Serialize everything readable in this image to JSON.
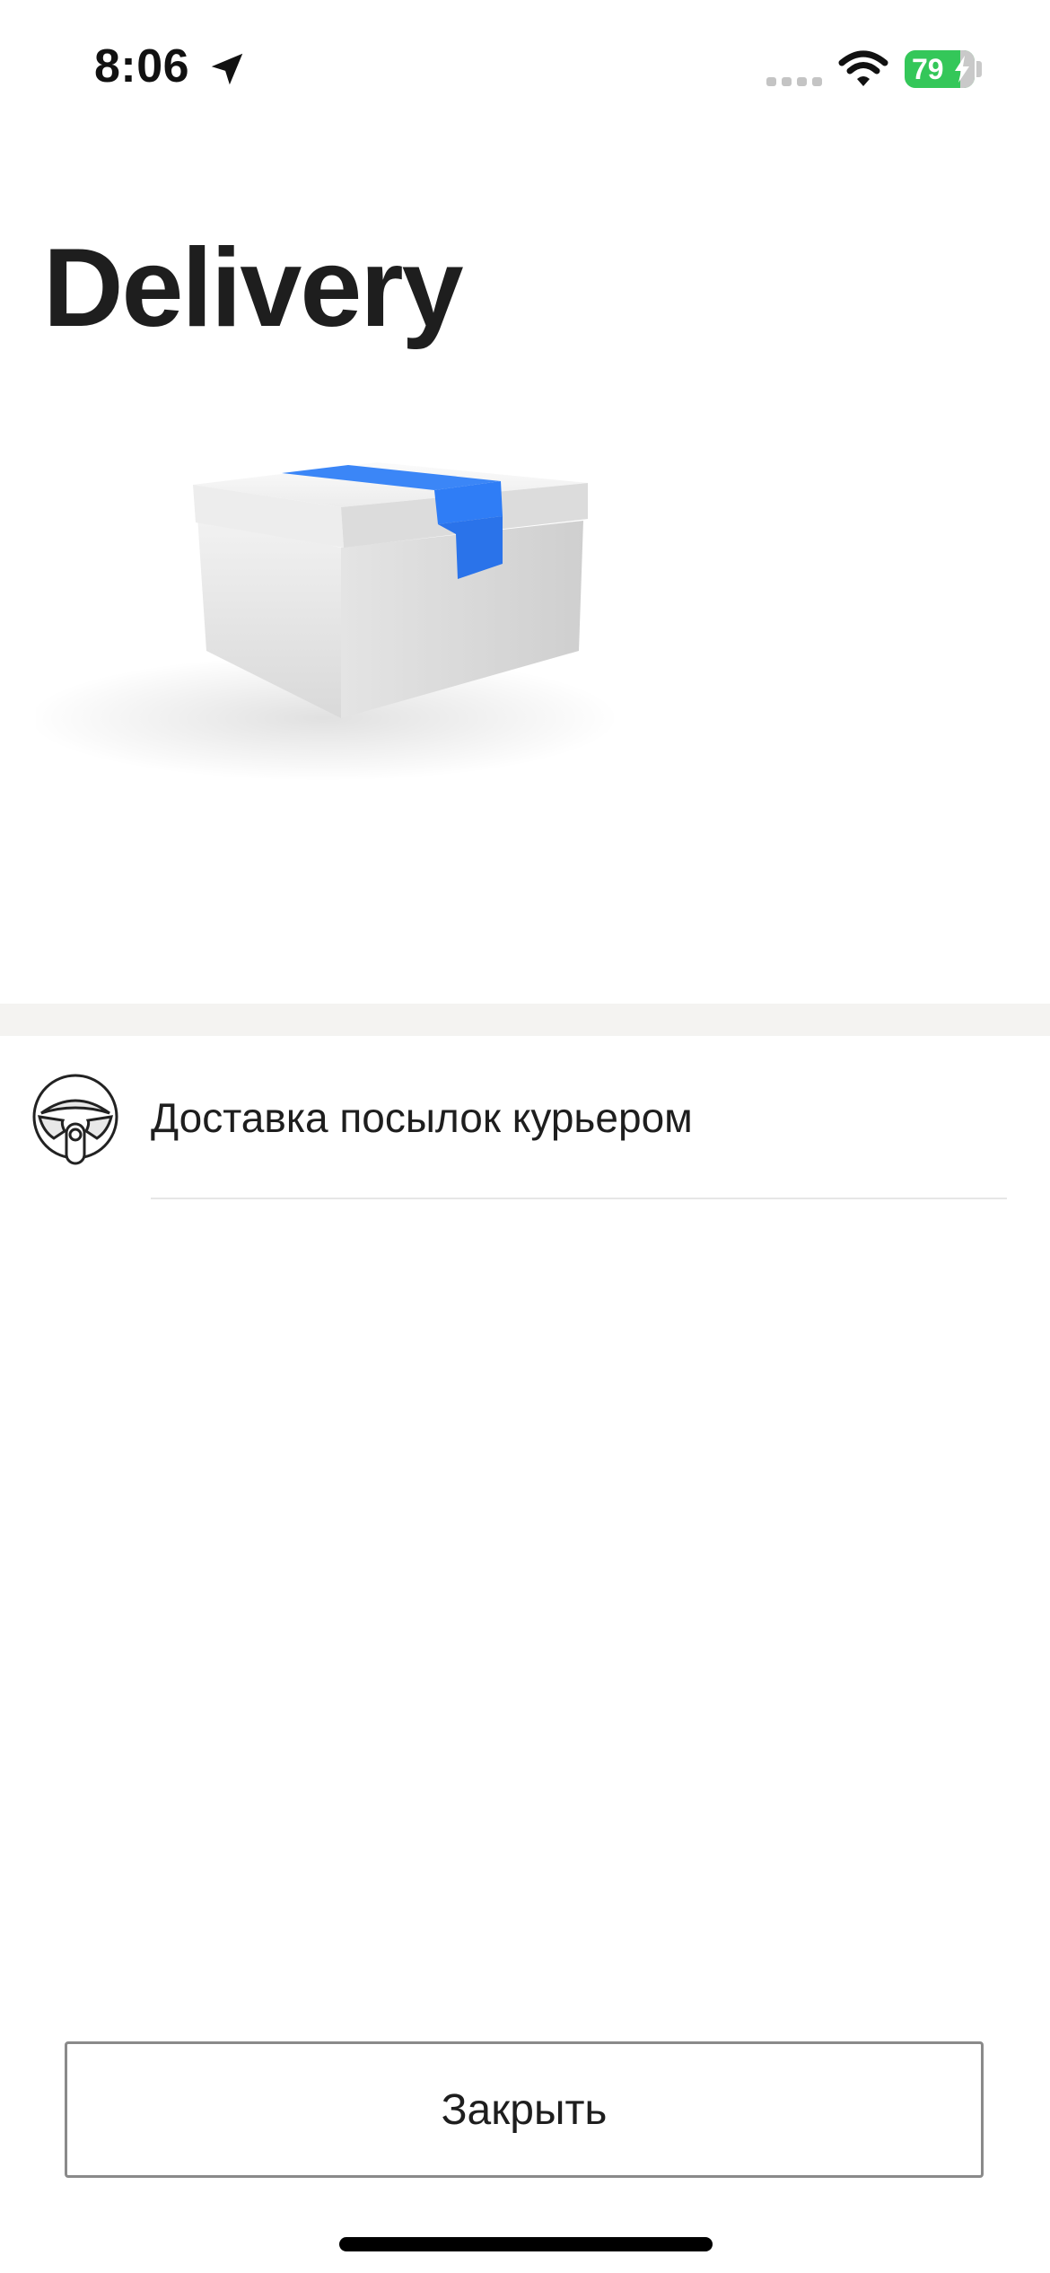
{
  "status_bar": {
    "time": "8:06",
    "battery_level": "79",
    "icons": [
      "location-arrow-icon",
      "cellular-signal-icon",
      "wifi-icon",
      "battery-charging-icon"
    ]
  },
  "page": {
    "title": "Delivery"
  },
  "hero": {
    "image": "parcel-box-illustration",
    "tape_color": "#2f7df6"
  },
  "list": {
    "items": [
      {
        "icon": "steering-wheel-icon",
        "label": "Доставка посылок курьером"
      }
    ]
  },
  "footer": {
    "close_label": "Закрыть"
  },
  "colors": {
    "battery": "#34c759",
    "separator": "#f4f3f1",
    "button_border": "#8a8a8a"
  }
}
